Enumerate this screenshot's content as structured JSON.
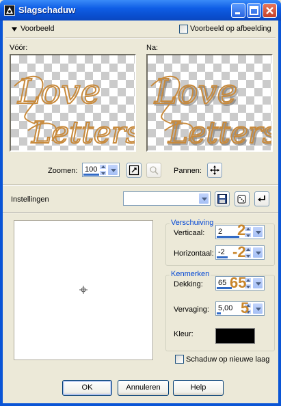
{
  "window": {
    "title": "Slagschaduw"
  },
  "header": {
    "preview_toggle_label": "Voorbeeld",
    "preview_on_image_label": "Voorbeeld op afbeelding",
    "preview_on_image_checked": false
  },
  "previews": {
    "before_label": "Vóór:",
    "after_label": "Na:",
    "artwork_text_line1": "Love",
    "artwork_text_line2": "Letters"
  },
  "zoom": {
    "label": "Zoomen:",
    "value": "100",
    "pan_label": "Pannen:"
  },
  "settings": {
    "label": "Instellingen",
    "preset_value": ""
  },
  "offset_group": {
    "title": "Verschuiving",
    "vertical_label": "Verticaal:",
    "vertical_value": "2",
    "vertical_annotation": "2",
    "horizontal_label": "Horizontaal:",
    "horizontal_value": "-2",
    "horizontal_annotation": "-2"
  },
  "attributes_group": {
    "title": "Kenmerken",
    "opacity_label": "Dekking:",
    "opacity_value": "65",
    "opacity_annotation": "65",
    "blur_label": "Vervaging:",
    "blur_value": "5,00",
    "blur_annotation": "5",
    "color_label": "Kleur:",
    "color_value": "#000000"
  },
  "shadow_new_layer": {
    "label": "Schaduw op nieuwe laag",
    "checked": false
  },
  "buttons": {
    "ok": "OK",
    "cancel": "Annuleren",
    "help": "Help"
  },
  "colors": {
    "accent": "#0046D5",
    "annotation": "#C9862C",
    "titlebar": "#0A55D6",
    "dialog_bg": "#ECE9D8"
  }
}
